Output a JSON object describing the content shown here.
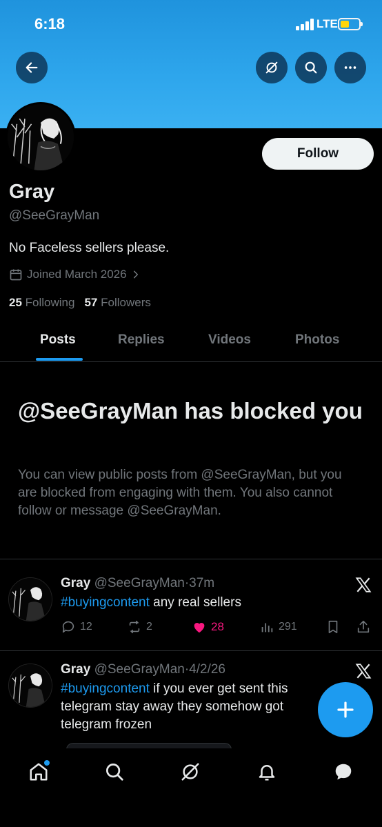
{
  "status_bar": {
    "time": "6:18",
    "network": "LTE"
  },
  "header": {
    "back_icon": "arrow-left-icon",
    "grok_icon": "grok-icon",
    "search_icon": "search-icon",
    "more_icon": "more-icon",
    "banner_color": "#2ea6ec"
  },
  "profile": {
    "follow_label": "Follow",
    "name": "Gray",
    "handle": "@SeeGrayMan",
    "bio": "No Faceless sellers please.",
    "joined": "Joined March 2026",
    "following_count": "25",
    "following_label": "Following",
    "followers_count": "57",
    "followers_label": "Followers"
  },
  "tabs": [
    {
      "label": "Posts",
      "active": true
    },
    {
      "label": "Replies",
      "active": false
    },
    {
      "label": "Videos",
      "active": false
    },
    {
      "label": "Photos",
      "active": false
    }
  ],
  "blocked": {
    "title": "@SeeGrayMan has blocked you",
    "description": "You can view public posts from @SeeGrayMan, but you are blocked from engaging with them. You also cannot follow or message @SeeGrayMan."
  },
  "tweets": [
    {
      "name": "Gray",
      "handle": "@SeeGrayMan",
      "time": "37m",
      "hashtag": "#buyingcontent",
      "text": " any real sellers",
      "replies": "12",
      "reposts": "2",
      "likes": "28",
      "views": "291"
    },
    {
      "name": "Gray",
      "handle": "@SeeGrayMan",
      "time": "4/2/26",
      "hashtag": "#buyingcontent",
      "text": " if you ever get sent this telegram stay away they  somehow got telegram frozen"
    }
  ],
  "colors": {
    "accent": "#1d9bf0",
    "like": "#f91880",
    "muted": "#71767b"
  },
  "bottom_nav": [
    "home-icon",
    "search-icon",
    "grok-icon",
    "notifications-icon",
    "messages-icon"
  ]
}
